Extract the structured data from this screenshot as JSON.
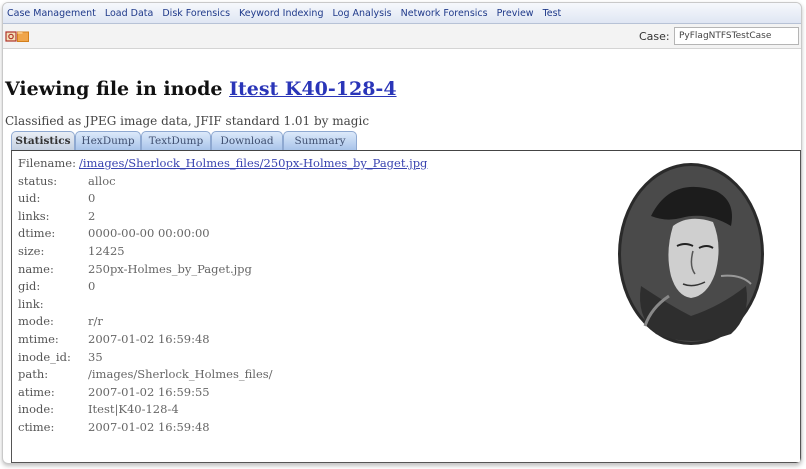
{
  "menu": {
    "items": [
      "Case Management",
      "Load Data",
      "Disk Forensics",
      "Keyword Indexing",
      "Log Analysis",
      "Network Forensics",
      "Preview",
      "Test"
    ]
  },
  "toolbar": {
    "icons": [
      "home-icon",
      "folder-icon"
    ],
    "case_label": "Case:",
    "case_value": "PyFlagNTFSTestCase"
  },
  "page": {
    "heading_prefix": "Viewing file in inode",
    "heading_link": "Itest K40-128-4",
    "classified": "Classified as JPEG image data, JFIF standard 1.01 by magic"
  },
  "tabs": [
    "Statistics",
    "HexDump",
    "TextDump",
    "Download",
    "Summary"
  ],
  "stats": {
    "filename_label": "Filename:",
    "filename_value": "/images/Sherlock_Holmes_files/250px-Holmes_by_Paget.jpg",
    "fields": [
      {
        "label": "status:",
        "value": "alloc"
      },
      {
        "label": "uid:",
        "value": "0"
      },
      {
        "label": "links:",
        "value": "2"
      },
      {
        "label": "dtime:",
        "value": "0000-00-00 00:00:00"
      },
      {
        "label": "size:",
        "value": "12425"
      },
      {
        "label": "name:",
        "value": "250px-Holmes_by_Paget.jpg"
      },
      {
        "label": "gid:",
        "value": "0"
      },
      {
        "label": "link:",
        "value": ""
      },
      {
        "label": "mode:",
        "value": "r/r"
      },
      {
        "label": "mtime:",
        "value": "2007-01-02 16:59:48"
      },
      {
        "label": "inode_id:",
        "value": "35"
      },
      {
        "label": "path:",
        "value": "/images/Sherlock_Holmes_files/"
      },
      {
        "label": "atime:",
        "value": "2007-01-02 16:59:55"
      },
      {
        "label": "inode:",
        "value": "Itest|K40-128-4"
      },
      {
        "label": "ctime:",
        "value": "2007-01-02 16:59:48"
      }
    ]
  },
  "colors": {
    "link": "#2a35b8",
    "tab_bg": "#a9c4ea",
    "menu_text": "#1f3a8a"
  }
}
